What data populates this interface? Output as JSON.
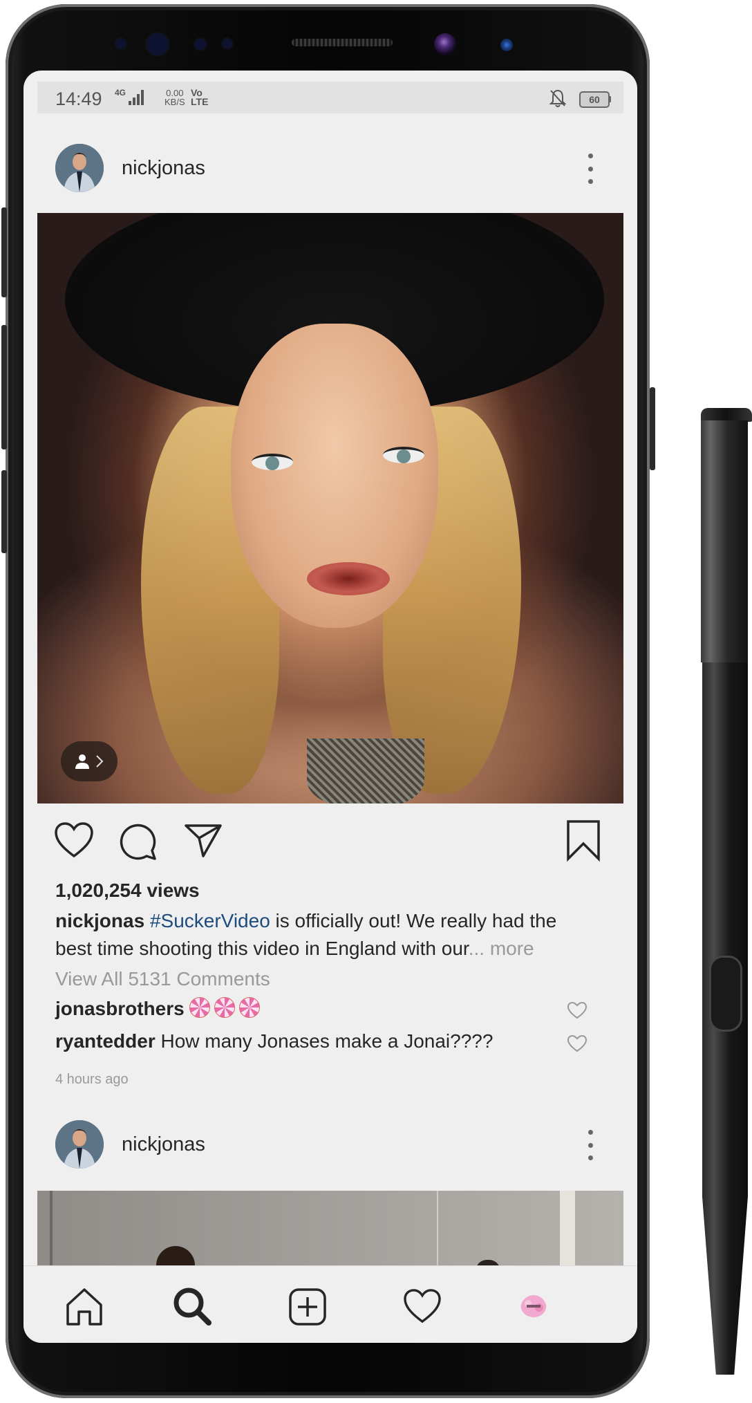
{
  "status_bar": {
    "time": "14:49",
    "network": "4G",
    "speed_value": "0.00",
    "speed_unit": "KB/S",
    "volte_top": "Vo",
    "volte_bottom": "LTE",
    "battery": "60",
    "icons": [
      "signal-icon",
      "mute-bell-icon",
      "battery-icon"
    ]
  },
  "post1": {
    "username": "nickjonas",
    "views": "1,020,254 views",
    "caption_user": "nickjonas",
    "caption_hashtag": "#SuckerVideo",
    "caption_text": " is officially out! We really had the best time shooting this video in England with our",
    "caption_more": "... more",
    "view_all": "View All 5131 Comments",
    "comments": [
      {
        "user": "jonasbrothers",
        "text": "",
        "emoji": "lollipop x3"
      },
      {
        "user": "ryantedder",
        "text": " How many Jonases make a Jonai????"
      }
    ],
    "time_ago": "4 hours ago",
    "actions": [
      "heart-icon",
      "comment-icon",
      "share-icon",
      "bookmark-icon"
    ],
    "tag_badge_icon": "person-tag-icon"
  },
  "post2": {
    "username": "nickjonas"
  },
  "bottom_nav": [
    "home-icon",
    "search-icon",
    "add-post-icon",
    "activity-heart-icon",
    "profile-avatar-icon"
  ],
  "colors": {
    "hashtag": "#1e4b7d",
    "background": "#efefef",
    "text": "#262626",
    "muted": "#999999"
  }
}
